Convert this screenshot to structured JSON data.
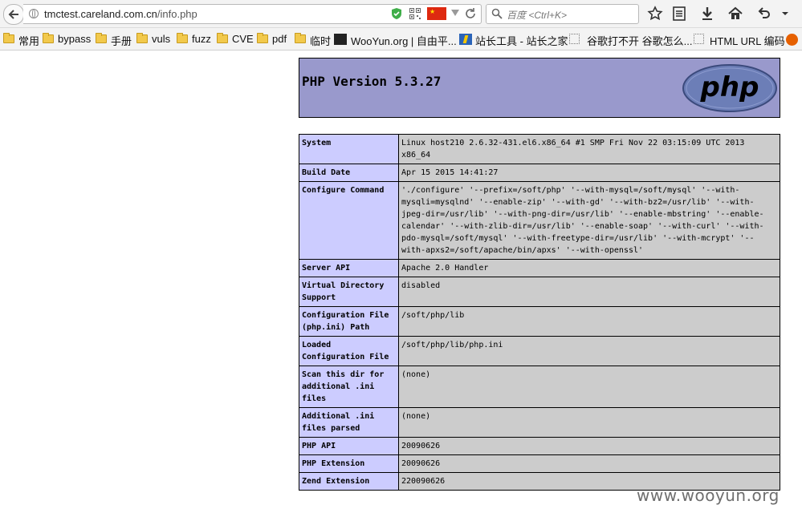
{
  "browser": {
    "url_host": "tmctest.careland.com.cn",
    "url_path": "/info.php",
    "search_placeholder": "百度 <Ctrl+K>"
  },
  "bookmarks": [
    {
      "label": "常用",
      "icon": "folder-icon"
    },
    {
      "label": "bypass",
      "icon": "folder-icon"
    },
    {
      "label": "手册",
      "icon": "folder-icon"
    },
    {
      "label": "vuls",
      "icon": "folder-icon"
    },
    {
      "label": "fuzz",
      "icon": "folder-icon"
    },
    {
      "label": "CVE",
      "icon": "folder-icon"
    },
    {
      "label": "pdf",
      "icon": "folder-icon"
    },
    {
      "label": "临时",
      "icon": "folder-icon"
    },
    {
      "label": "WooYun.org | 自由平...",
      "icon": "wooyun-icon"
    },
    {
      "label": "站长工具 - 站长之家",
      "icon": "chinaz-icon"
    },
    {
      "label": "谷歌打不开 谷歌怎么...",
      "icon": "page-icon"
    },
    {
      "label": "HTML URL 编码",
      "icon": "page-icon"
    }
  ],
  "php": {
    "version_title": "PHP Version 5.3.27",
    "logo_text": "php"
  },
  "info_rows": [
    {
      "key": "System",
      "value": "Linux host210 2.6.32-431.el6.x86_64 #1 SMP Fri Nov 22 03:15:09 UTC 2013 x86_64"
    },
    {
      "key": "Build Date",
      "value": "Apr 15 2015 14:41:27"
    },
    {
      "key": "Configure Command",
      "value": "'./configure' '--prefix=/soft/php' '--with-mysql=/soft/mysql' '--with-mysqli=mysqlnd' '--enable-zip' '--with-gd' '--with-bz2=/usr/lib' '--with-jpeg-dir=/usr/lib' '--with-png-dir=/usr/lib' '--enable-mbstring' '--enable-calendar' '--with-zlib-dir=/usr/lib' '--enable-soap' '--with-curl' '--with-pdo-mysql=/soft/mysql' '--with-freetype-dir=/usr/lib' '--with-mcrypt' '--with-apxs2=/soft/apache/bin/apxs' '--with-openssl'"
    },
    {
      "key": "Server API",
      "value": "Apache 2.0 Handler"
    },
    {
      "key": "Virtual Directory Support",
      "value": "disabled"
    },
    {
      "key": "Configuration File (php.ini) Path",
      "value": "/soft/php/lib"
    },
    {
      "key": "Loaded Configuration File",
      "value": "/soft/php/lib/php.ini"
    },
    {
      "key": "Scan this dir for additional .ini files",
      "value": "(none)"
    },
    {
      "key": "Additional .ini files parsed",
      "value": "(none)"
    },
    {
      "key": "PHP API",
      "value": "20090626"
    },
    {
      "key": "PHP Extension",
      "value": "20090626"
    },
    {
      "key": "Zend Extension",
      "value": "220090626"
    }
  ],
  "watermark": "www.wooyun.org",
  "colors": {
    "header_bg": "#9999cc",
    "key_bg": "#ccccff",
    "value_bg": "#cccccc"
  }
}
